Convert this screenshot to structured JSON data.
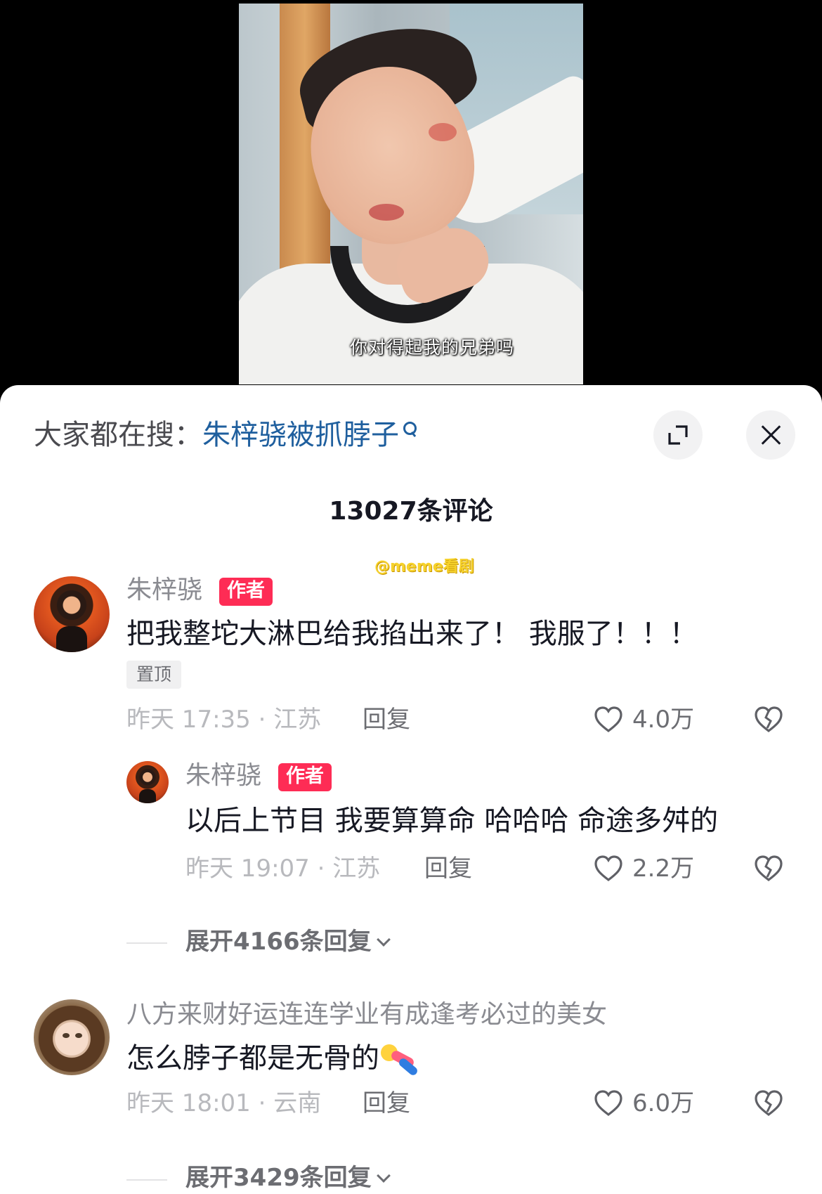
{
  "video": {
    "subtitle": "你对得起我的兄弟吗"
  },
  "sheet": {
    "search_prefix": "大家都在搜：",
    "search_term": "朱梓骁被抓脖子",
    "comment_count_title": "13027条评论",
    "watermark": "@meme看剧"
  },
  "comments": [
    {
      "author": "朱梓骁",
      "badge": "作者",
      "text": "把我整坨大淋巴给我掐出来了！ 我服了！！！",
      "pin": "置顶",
      "time_location": "昨天 17:35 · 江苏",
      "reply_label": "回复",
      "likes": "4.0万",
      "replies": [
        {
          "author": "朱梓骁",
          "badge": "作者",
          "text": "以后上节目 我要算算命 哈哈哈 命途多舛的",
          "time_location": "昨天 19:07 · 江苏",
          "reply_label": "回复",
          "likes": "2.2万"
        }
      ],
      "expand_label": "展开4166条回复"
    },
    {
      "author": "八方来财好运连连学业有成逢考必过的美女",
      "text": "怎么脖子都是无骨的",
      "time_location": "昨天 18:01 · 云南",
      "reply_label": "回复",
      "likes": "6.0万",
      "expand_label": "展开3429条回复"
    }
  ],
  "icons": {
    "search": "search-icon",
    "expand": "expand-icon",
    "close": "close-icon",
    "like": "heart-icon",
    "dislike": "broken-heart-icon",
    "chevron": "chevron-down-icon"
  },
  "colors": {
    "accent_link": "#1f5f9e",
    "author_badge": "#fe2c55",
    "watermark": "#f6d22c"
  }
}
